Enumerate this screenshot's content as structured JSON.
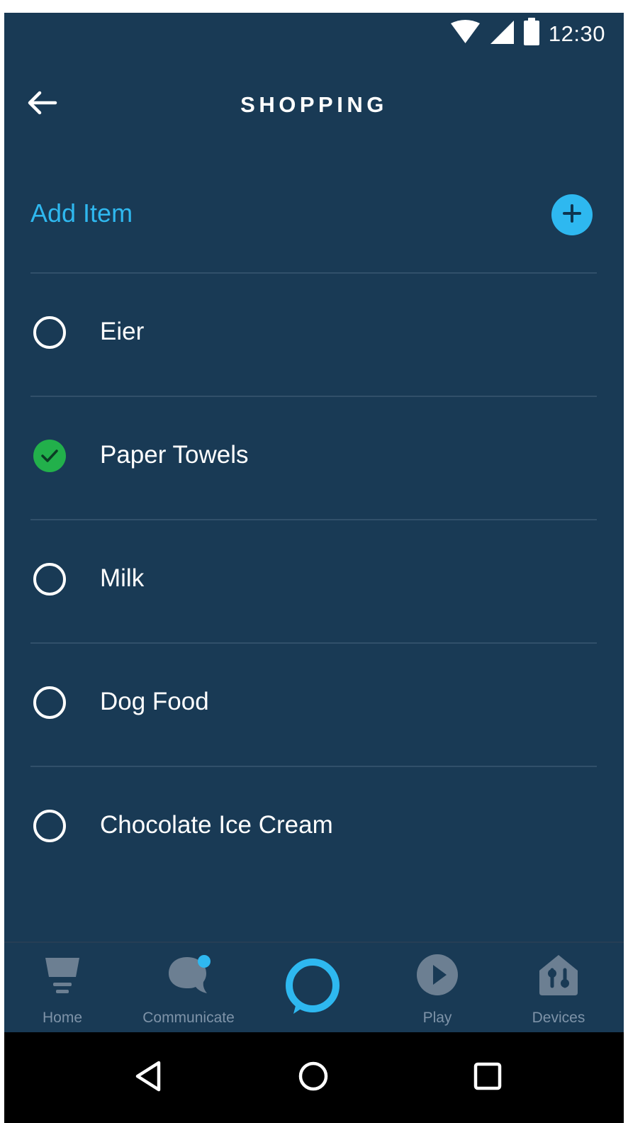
{
  "status_bar": {
    "time": "12:30",
    "icons": [
      "wifi-icon",
      "cellular-signal-icon",
      "battery-icon"
    ]
  },
  "header": {
    "title": "SHOPPING",
    "back_icon": "back-arrow-icon"
  },
  "add_item": {
    "label": "Add Item",
    "icon": "plus-circle-icon",
    "accent_color": "#2EB8F0"
  },
  "items": [
    {
      "label": "Eier",
      "checked": false
    },
    {
      "label": "Paper Towels",
      "checked": true
    },
    {
      "label": "Milk",
      "checked": false
    },
    {
      "label": "Dog Food",
      "checked": false
    },
    {
      "label": "Chocolate Ice Cream",
      "checked": false
    }
  ],
  "bottom_nav": [
    {
      "label": "Home",
      "icon": "home-icon"
    },
    {
      "label": "Communicate",
      "icon": "chat-bubble-icon",
      "has_notification": true
    },
    {
      "label": "",
      "icon": "alexa-ring-icon"
    },
    {
      "label": "Play",
      "icon": "play-icon"
    },
    {
      "label": "Devices",
      "icon": "devices-icon"
    }
  ],
  "system_nav": {
    "buttons": [
      "back-triangle-icon",
      "home-circle-icon",
      "recent-apps-icon"
    ]
  },
  "colors": {
    "background": "#193A55",
    "accent": "#2EB8F0",
    "check": "#22B04B",
    "text": "#FFFFFF",
    "nav_inactive": "#6C7F92",
    "divider": "#31506A"
  }
}
